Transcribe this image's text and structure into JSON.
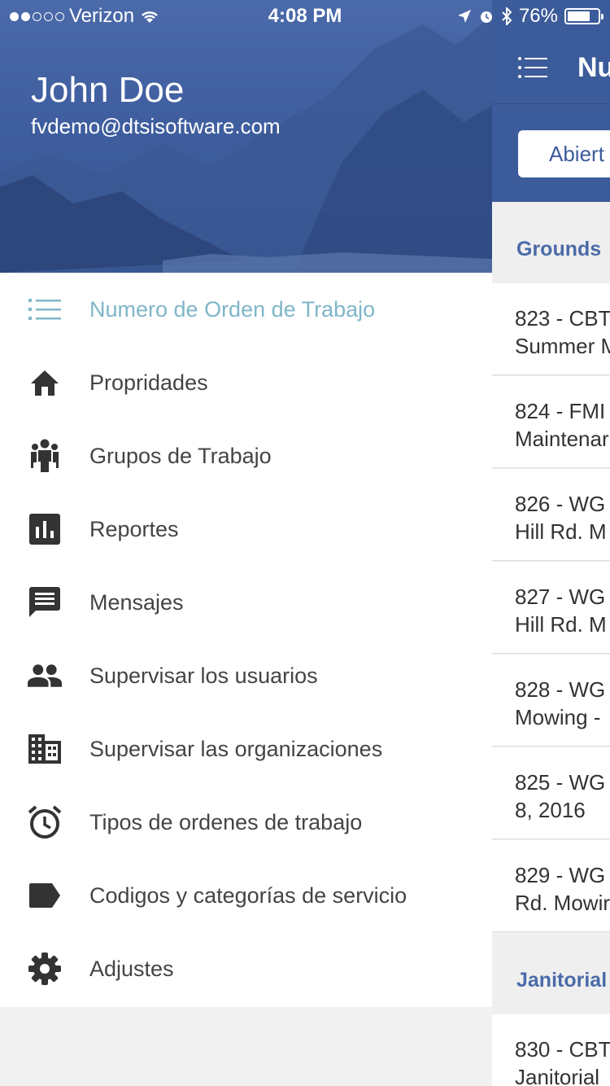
{
  "status_bar": {
    "carrier": "Verizon",
    "time": "4:08 PM",
    "battery_percent": "76%",
    "battery_level": 0.76
  },
  "drawer": {
    "user_name": "John Doe",
    "user_email": "fvdemo@dtsisoftware.com",
    "menu": [
      {
        "label": "Numero de Orden de Trabajo",
        "icon": "list-icon",
        "active": true
      },
      {
        "label": "Propridades",
        "icon": "home-icon"
      },
      {
        "label": "Grupos de Trabajo",
        "icon": "group-icon"
      },
      {
        "label": "Reportes",
        "icon": "bar-chart-icon"
      },
      {
        "label": "Mensajes",
        "icon": "message-icon"
      },
      {
        "label": "Supervisar los usuarios",
        "icon": "people-icon"
      },
      {
        "label": "Supervisar las organizaciones",
        "icon": "building-icon"
      },
      {
        "label": "Tipos de ordenes de trabajo",
        "icon": "alarm-clock-icon"
      },
      {
        "label": "Codigos y categorías de servicio",
        "icon": "label-tag-icon"
      },
      {
        "label": "Adjustes",
        "icon": "gear-icon"
      }
    ]
  },
  "main": {
    "title": "Nu",
    "filter_label": "Abiert",
    "sections": [
      {
        "name": "Grounds",
        "items": [
          {
            "line1": "823 - CBT",
            "line2": "Summer M"
          },
          {
            "line1": "824 - FMI",
            "line2": "Maintenar"
          },
          {
            "line1": "826 - WG",
            "line2": "Hill Rd. M"
          },
          {
            "line1": "827 - WG",
            "line2": "Hill Rd. M"
          },
          {
            "line1": "828 - WG",
            "line2": "Mowing -"
          },
          {
            "line1": "825 - WG",
            "line2": "8, 2016"
          },
          {
            "line1": "829 - WG",
            "line2": "Rd. Mowir"
          }
        ]
      },
      {
        "name": "Janitorial",
        "items": [
          {
            "line1": "830 - CBT",
            "line2": "Janitorial"
          }
        ]
      }
    ]
  },
  "colors": {
    "header_blue": "#3c5b9a",
    "active_item": "#7fb6c8",
    "icon_gray": "#333333"
  }
}
